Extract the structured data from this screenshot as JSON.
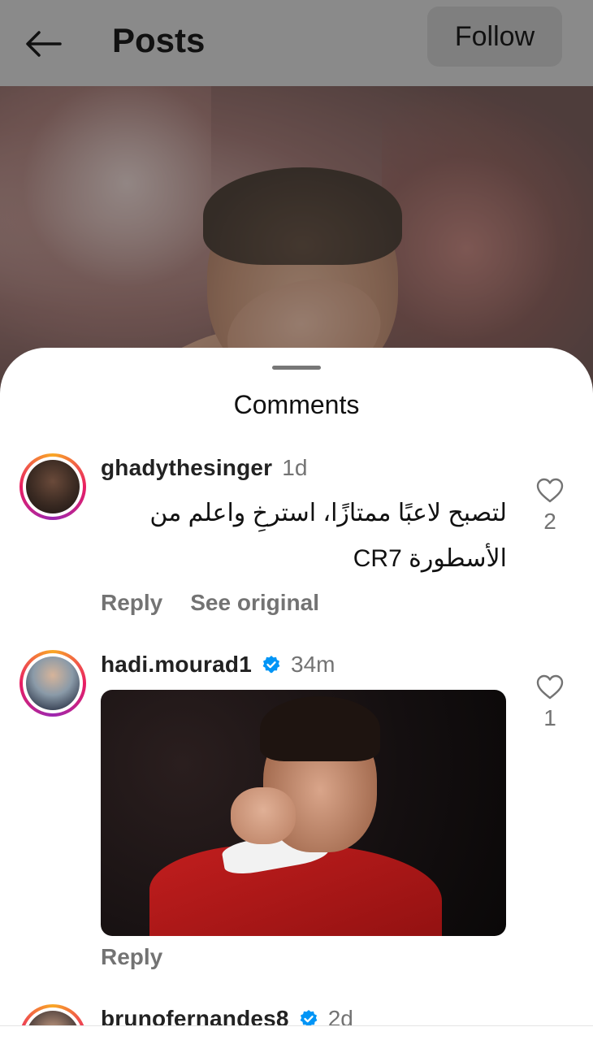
{
  "header": {
    "title": "Posts",
    "follow_label": "Follow",
    "back_icon": "arrow-left-icon"
  },
  "sheet": {
    "title": "Comments"
  },
  "comments": [
    {
      "username": "ghadythesinger",
      "verified": false,
      "time": "1d",
      "text": "لتصبح لاعبًا ممتازًا، استرخِ واعلم من الأسطورة CR7",
      "reply_label": "Reply",
      "see_original_label": "See original",
      "likes": "2"
    },
    {
      "username": "hadi.mourad1",
      "verified": true,
      "time": "34m",
      "attachment": "gif-image",
      "reply_label": "Reply",
      "likes": "1"
    },
    {
      "username": "brunofernandes8",
      "verified": true,
      "time": "2d"
    }
  ],
  "colors": {
    "verified": "#0095f6",
    "muted_text": "#737373",
    "overlay": "#8a8a8a"
  }
}
